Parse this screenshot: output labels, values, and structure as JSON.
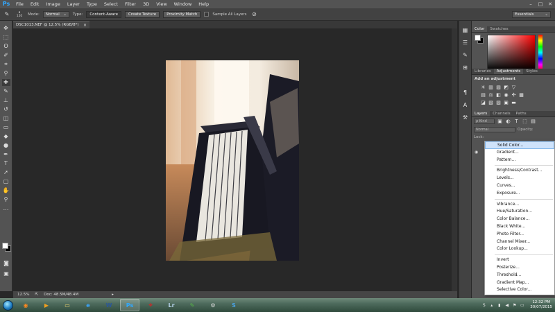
{
  "app": {
    "logo": "Ps",
    "brand_color": "#31a8ff"
  },
  "menu": [
    "File",
    "Edit",
    "Image",
    "Layer",
    "Type",
    "Select",
    "Filter",
    "3D",
    "View",
    "Window",
    "Help"
  ],
  "window_controls": [
    "–",
    "□",
    "✕"
  ],
  "options": {
    "brush_size": "120",
    "mode_label": "Mode:",
    "mode_value": "Normal",
    "type_label": "Type:",
    "type_buttons": [
      "Content-Aware",
      "Create Texture",
      "Proximity Match"
    ],
    "sample_all_layers": "Sample All Layers",
    "workspace": "Essentials"
  },
  "document": {
    "tab_title": "DSC1013.NEF @ 12.5% (RGB/8*)",
    "close": "×",
    "zoom": "12.5%",
    "doc_size": "Doc: 48.5M/48.4M"
  },
  "panels": {
    "color_tabs": [
      "Color",
      "Swatches"
    ],
    "adj_tabs": [
      "Libraries",
      "Adjustments",
      "Styles"
    ],
    "add_adjustment": "Add an adjustment",
    "layer_tabs": [
      "Layers",
      "Channels",
      "Paths"
    ],
    "kind_filter": "ρ Kind",
    "blend_mode": "Normal",
    "opacity_label": "Opacity:",
    "lock_label": "Lock:"
  },
  "adjustment_menu": {
    "groups": [
      [
        "Solid Color...",
        "Gradient...",
        "Pattern..."
      ],
      [
        "Brightness/Contrast...",
        "Levels...",
        "Curves...",
        "Exposure..."
      ],
      [
        "Vibrance...",
        "Hue/Saturation...",
        "Color Balance...",
        "Black  White...",
        "Photo Filter...",
        "Channel Mixer...",
        "Color Lookup..."
      ],
      [
        "Invert",
        "Posterize...",
        "Threshold...",
        "Gradient Map...",
        "Selective Color..."
      ]
    ],
    "highlighted": "Solid Color..."
  },
  "taskbar": {
    "apps": [
      {
        "name": "firefox",
        "glyph": "◉",
        "color": "#ff8a1f"
      },
      {
        "name": "media-player",
        "glyph": "▶",
        "color": "#f0a020"
      },
      {
        "name": "explorer",
        "glyph": "▭",
        "color": "#f5d76e"
      },
      {
        "name": "internet-explorer",
        "glyph": "e",
        "color": "#3aa6ff"
      },
      {
        "name": "word",
        "glyph": "W",
        "color": "#2b5797"
      },
      {
        "name": "photoshop",
        "glyph": "Ps",
        "color": "#31a8ff"
      },
      {
        "name": "acrobat",
        "glyph": "⟡",
        "color": "#e02020"
      },
      {
        "name": "lightroom",
        "glyph": "Lr",
        "color": "#b3d0e6"
      },
      {
        "name": "evernote",
        "glyph": "✎",
        "color": "#58b947"
      },
      {
        "name": "tool",
        "glyph": "⚙",
        "color": "#ddd"
      },
      {
        "name": "app-s",
        "glyph": "S",
        "color": "#4aa0e0"
      }
    ],
    "time": "12:32 PM",
    "date": "30/07/2015"
  }
}
